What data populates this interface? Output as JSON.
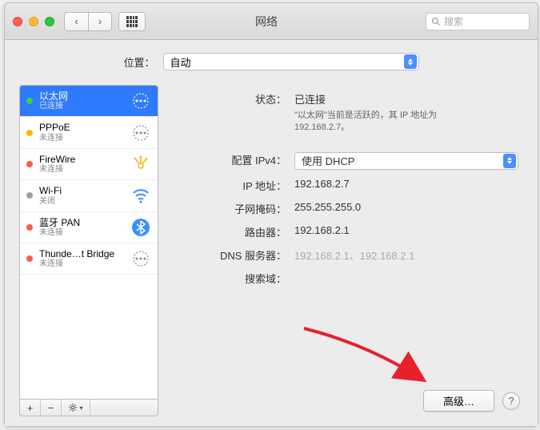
{
  "window": {
    "title": "网络",
    "search_placeholder": "搜索"
  },
  "location": {
    "label": "位置：",
    "value": "自动"
  },
  "sidebar": {
    "items": [
      {
        "name": "以太网",
        "status": "已连接",
        "dot": "#37d63b"
      },
      {
        "name": "PPPoE",
        "status": "未连接",
        "dot": "#ffb400"
      },
      {
        "name": "FireWire",
        "status": "未连接",
        "dot": "#ff5a3c"
      },
      {
        "name": "Wi-Fi",
        "status": "关闭",
        "dot": "#a0a0a0"
      },
      {
        "name": "蓝牙 PAN",
        "status": "未连接",
        "dot": "#ff5a3c"
      },
      {
        "name": "Thunde…t Bridge",
        "status": "未连接",
        "dot": "#ff5a3c"
      }
    ]
  },
  "detail": {
    "status_label": "状态：",
    "status_value": "已连接",
    "status_sub": "\"以太网\"当前是活跃的，其 IP 地址为 192.168.2.7。",
    "config_label": "配置 IPv4：",
    "config_value": "使用 DHCP",
    "ip_label": "IP 地址：",
    "ip_value": "192.168.2.7",
    "mask_label": "子网掩码：",
    "mask_value": "255.255.255.0",
    "router_label": "路由器：",
    "router_value": "192.168.2.1",
    "dns_label": "DNS 服务器：",
    "dns_value": "192.168.2.1、192.168.2.1",
    "search_label": "搜索域：",
    "advanced_btn": "高级…"
  }
}
